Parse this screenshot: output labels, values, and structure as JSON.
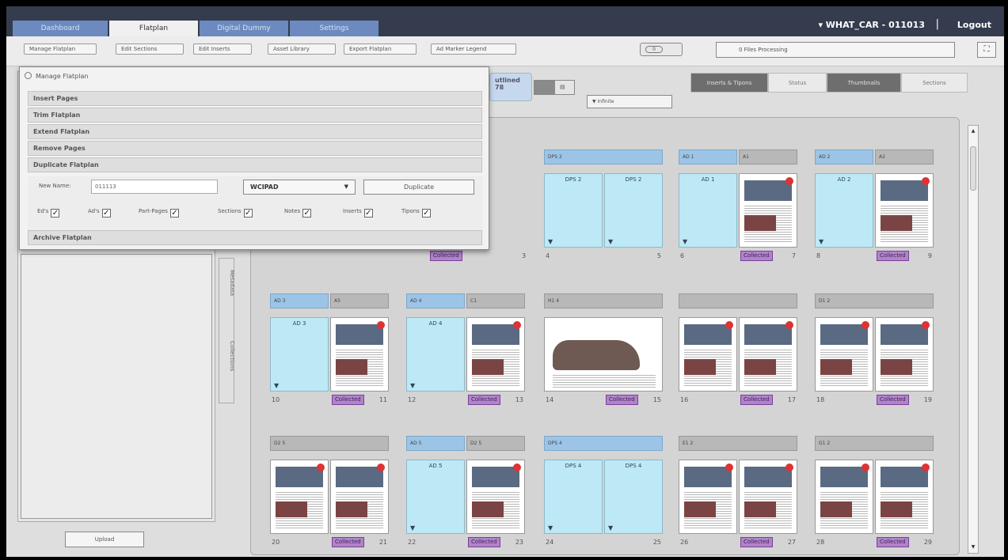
{
  "nav": {
    "tabs": [
      "Dashboard",
      "Flatplan",
      "Digital Dummy",
      "Settings"
    ],
    "active_tab": "Flatplan",
    "user": "▾ WHAT_CAR - 011013",
    "separator": "|",
    "logout": "Logout"
  },
  "toolbar": {
    "buttons": [
      "Manage Flatplan",
      "Edit Sections",
      "Edit Inserts",
      "Asset Library",
      "Export Flatplan",
      "Ad Marker Legend"
    ],
    "toggle_label": "0",
    "processing": "0 Files Processing",
    "fit_icon": "fit-screen-icon"
  },
  "popup": {
    "title": "Manage Flatplan",
    "sections": [
      "Insert Pages",
      "Trim Flatplan",
      "Extend Flatplan",
      "Remove Pages",
      "Duplicate Flatplan"
    ],
    "archive": "Archive Flatplan",
    "new_name_label": "New Name:",
    "new_name_value": "011113",
    "select_value": "WCIPAD",
    "duplicate_button": "Duplicate",
    "checkboxes": [
      "Ed's",
      "Ad's",
      "Part-Pages",
      "Sections",
      "Notes",
      "Inserts",
      "Tipons"
    ]
  },
  "right": {
    "outlined": "utlined\n78",
    "zoom_select": "▼ Infinite",
    "view_tabs": [
      "Inserts & Tipons",
      "Status",
      "Thumbnails",
      "Sections"
    ],
    "active_view": "Thumbnails"
  },
  "side": {
    "tabs": [
      "Metadata",
      "Collections"
    ],
    "upload": "Upload"
  },
  "collected_label": "Collected",
  "grid": [
    {
      "headers": [
        {
          "text": "DPS 2",
          "blue": true
        }
      ],
      "left": "DPS 2",
      "right": "DPS 2",
      "types": [
        "ad",
        "ad"
      ],
      "nums": [
        "4",
        "5"
      ],
      "collected": false
    },
    {
      "headers": [
        {
          "text": "AD 1",
          "blue": true
        },
        {
          "text": "A1",
          "blue": false
        }
      ],
      "left": "AD 1",
      "right": "",
      "types": [
        "ad",
        "mag"
      ],
      "nums": [
        "6",
        "7"
      ],
      "collected": true
    },
    {
      "headers": [
        {
          "text": "AD 2",
          "blue": true
        },
        {
          "text": "A2",
          "blue": false
        }
      ],
      "left": "AD 2",
      "right": "",
      "types": [
        "ad",
        "mag"
      ],
      "nums": [
        "8",
        "9"
      ],
      "collected": true
    },
    {
      "headers": [
        {
          "text": "AD 3",
          "blue": true
        },
        {
          "text": "A5",
          "blue": false
        }
      ],
      "left": "AD 3",
      "right": "",
      "types": [
        "ad",
        "mag"
      ],
      "nums": [
        "10",
        "11"
      ],
      "collected": true
    },
    {
      "headers": [
        {
          "text": "AD 4",
          "blue": true
        },
        {
          "text": "C1",
          "blue": false
        }
      ],
      "left": "AD 4",
      "right": "",
      "types": [
        "ad",
        "mag"
      ],
      "nums": [
        "12",
        "13"
      ],
      "collected": true
    },
    {
      "headers": [
        {
          "text": "H1 4",
          "blue": false
        }
      ],
      "left": "",
      "right": "",
      "types": [
        "spread",
        "spread"
      ],
      "nums": [
        "14",
        "15"
      ],
      "collected": true
    },
    {
      "headers": [
        {
          "text": "",
          "blue": false
        }
      ],
      "left": "",
      "right": "",
      "types": [
        "mag",
        "mag"
      ],
      "nums": [
        "16",
        "17"
      ],
      "collected": true
    },
    {
      "headers": [
        {
          "text": "D1 2",
          "blue": false
        }
      ],
      "left": "",
      "right": "",
      "types": [
        "mag",
        "mag"
      ],
      "nums": [
        "18",
        "19"
      ],
      "collected": true
    },
    {
      "headers": [
        {
          "text": "D2 5",
          "blue": false
        }
      ],
      "left": "",
      "right": "",
      "types": [
        "mag",
        "mag"
      ],
      "nums": [
        "20",
        "21"
      ],
      "collected": true
    },
    {
      "headers": [
        {
          "text": "AD 5",
          "blue": true
        },
        {
          "text": "D2 5",
          "blue": false
        }
      ],
      "left": "AD 5",
      "right": "",
      "types": [
        "ad",
        "mag"
      ],
      "nums": [
        "22",
        "23"
      ],
      "collected": true
    },
    {
      "headers": [
        {
          "text": "DPS 4",
          "blue": true
        }
      ],
      "left": "DPS 4",
      "right": "DPS 4",
      "types": [
        "ad",
        "ad"
      ],
      "nums": [
        "24",
        "25"
      ],
      "collected": false
    },
    {
      "headers": [
        {
          "text": "E1 2",
          "blue": false
        }
      ],
      "left": "",
      "right": "",
      "types": [
        "mag",
        "mag"
      ],
      "nums": [
        "26",
        "27"
      ],
      "collected": true
    },
    {
      "headers": [
        {
          "text": "G1 2",
          "blue": false
        }
      ],
      "left": "",
      "right": "",
      "types": [
        "mag",
        "mag"
      ],
      "nums": [
        "28",
        "29"
      ],
      "collected": true
    }
  ],
  "partial_row": {
    "num": "3",
    "collected": "Collected"
  }
}
